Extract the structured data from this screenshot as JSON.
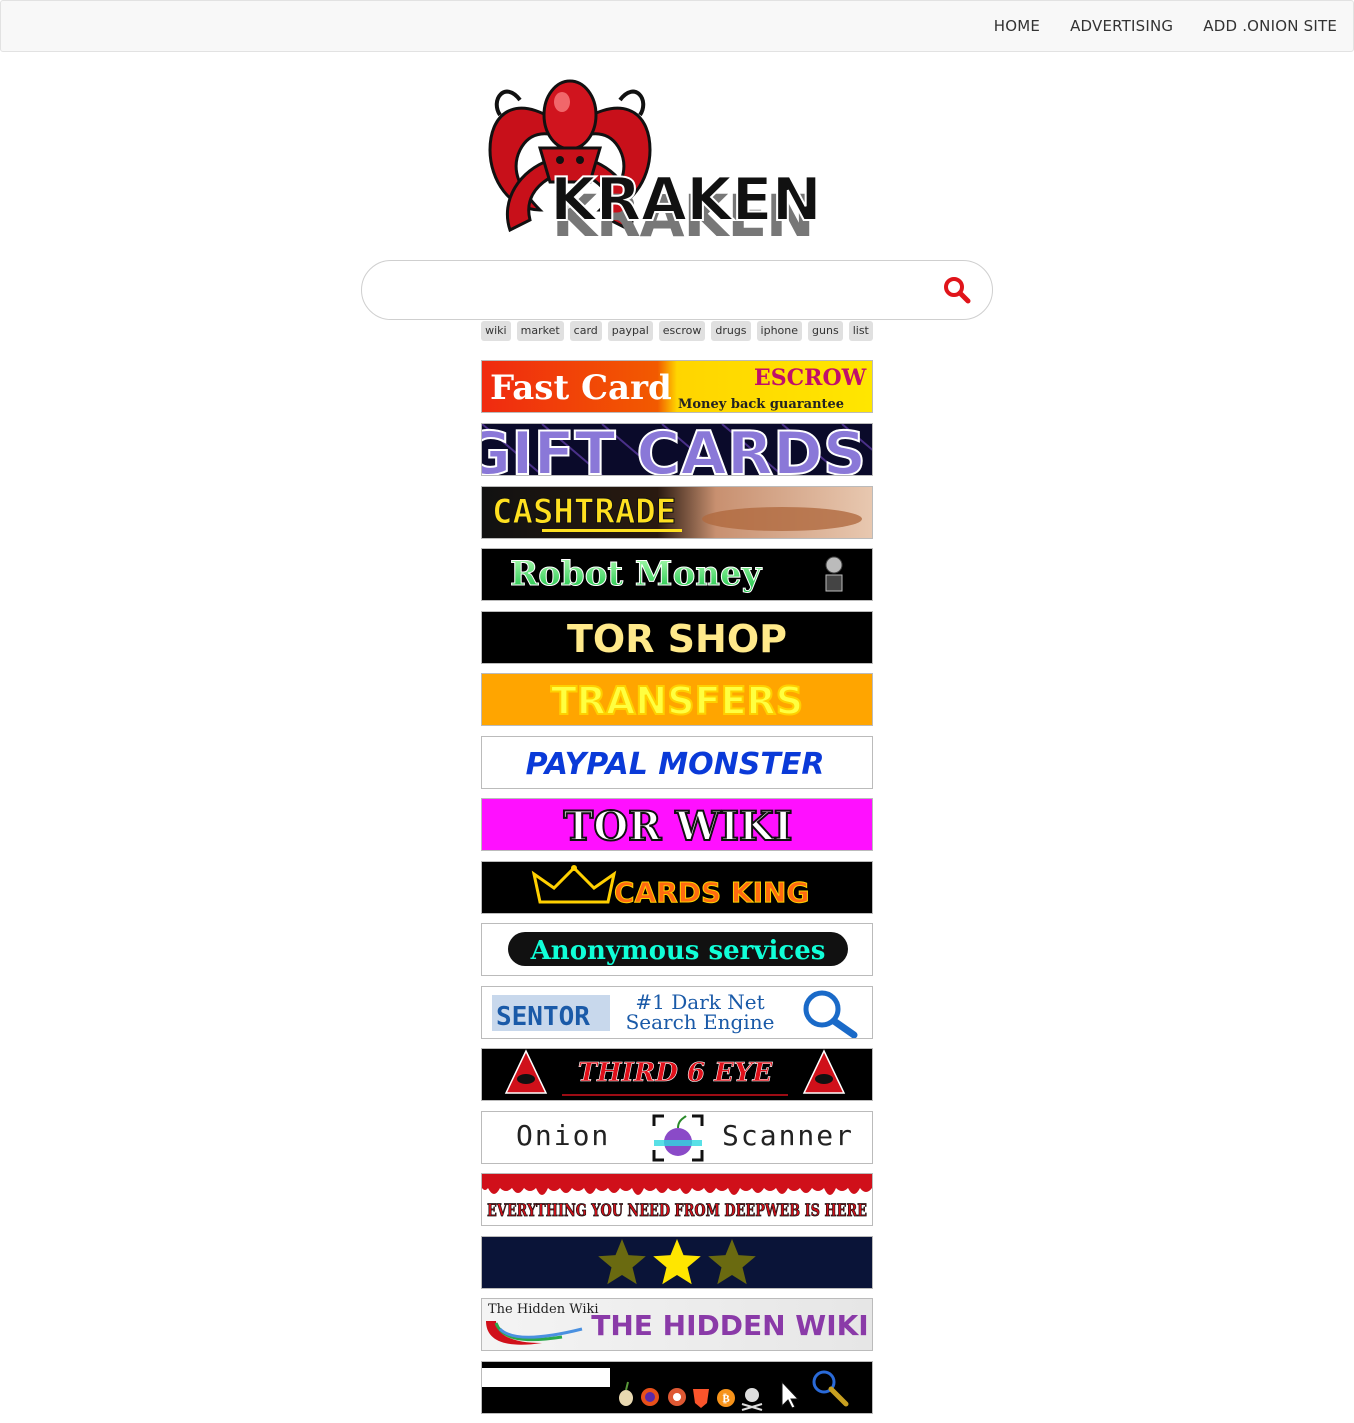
{
  "nav": {
    "home": "HOME",
    "advertising": "ADVERTISING",
    "add_site": "ADD .ONION SITE"
  },
  "logo": {
    "text": "KRAKEN"
  },
  "search": {
    "placeholder": "",
    "icon": "search-icon"
  },
  "tags": [
    "wiki",
    "market",
    "card",
    "paypal",
    "escrow",
    "drugs",
    "iphone",
    "guns",
    "list"
  ],
  "banners": {
    "fast_card": {
      "title": "Fast Card",
      "escrow": "ESCROW",
      "sub": "Money back guarantee"
    },
    "gift_cards": {
      "title": "GIFT CARDS"
    },
    "cashtrade": {
      "title": "CASHTRADE"
    },
    "robot_money": {
      "title": "Robot Money"
    },
    "tor_shop": {
      "title": "TOR SHOP"
    },
    "transfers": {
      "title": "TRANSFERS"
    },
    "paypal_monster": {
      "title": "PAYPAL MONSTER"
    },
    "tor_wiki": {
      "title": "TOR WIKI"
    },
    "cards_king": {
      "title": "CARDS KING"
    },
    "anonymous": {
      "title": "Anonymous services"
    },
    "sentor": {
      "logo": "SENTOR",
      "line1": "#1 Dark Net",
      "line2": "Search Engine"
    },
    "third_eye": {
      "title": "THIRD 6 EYE"
    },
    "onion_scanner": {
      "left": "Onion",
      "right": "Scanner"
    },
    "deepweb": {
      "title": "EVERYTHING YOU NEED FROM DEEPWEB IS HERE"
    },
    "stars": {
      "count": 3
    },
    "hidden_wiki": {
      "small": "The Hidden Wiki",
      "title": "THE HIDDEN WIKI"
    },
    "browser": {
      "icons": [
        "onion-icon",
        "firefox-icon",
        "duckduckgo-icon",
        "brave-icon",
        "bitcoin-icon",
        "skull-icon",
        "cursor-icon",
        "magnifier-icon"
      ]
    }
  },
  "colors": {
    "logo_red": "#d0141e",
    "search_icon": "#e0141a",
    "nav_bg": "#f8f8f8",
    "tag_bg": "#e0e0e0"
  }
}
